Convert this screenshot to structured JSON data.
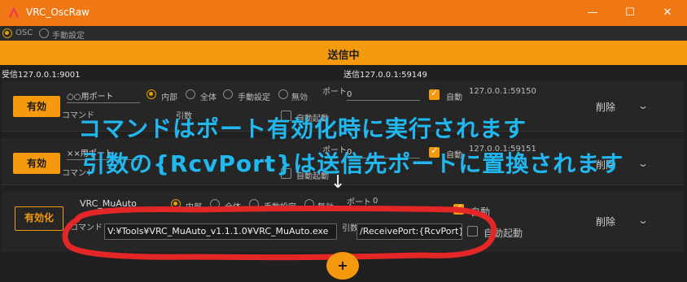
{
  "window": {
    "title": "VRC_OscRaw",
    "minimize": "—",
    "maximize": "☐",
    "close": "✕"
  },
  "mode": {
    "osc_label": "OSC",
    "manual_label": "手動設定"
  },
  "sendbar": {
    "label": "送信中"
  },
  "addresses": {
    "receive": "受信127.0.0.1:9001",
    "send": "送信127.0.0.1:59149"
  },
  "rows": [
    {
      "button": "有効",
      "name_label": "○○用ポート",
      "cmd_label": "コマンド",
      "opt_internal": "内部",
      "opt_all": "全体",
      "opt_manual": "手動設定",
      "opt_none": "無効",
      "port_label": "ポート",
      "port_value": "0",
      "arg_label": "引数",
      "auto_label": "自動",
      "autostart_label": "自動起動",
      "addr": "127.0.0.1:59150",
      "delete": "削除"
    },
    {
      "button": "有効",
      "name_label": "××用ポート",
      "cmd_label": "コマンド",
      "port_label": "ポート",
      "port_value": "0",
      "auto_label": "自動",
      "autostart_label": "自動起動",
      "addr": "127.0.0.1:59151",
      "delete": "削除"
    },
    {
      "button": "有効化",
      "name_label": "VRC_MuAuto",
      "cmd_label": "コマンド",
      "opt_internal": "内部",
      "opt_all": "全体",
      "opt_manual": "手動設定",
      "opt_none": "無効",
      "port_label": "ポート",
      "port_value": "0",
      "arg_label": "引数",
      "exe_value": "V:¥Tools¥VRC_MuAuto_v1.1.1.0¥VRC_MuAuto.exe",
      "arg_value": "/ReceivePort:{RcvPort}",
      "auto_label": "自動",
      "autostart_label": "自動起動",
      "delete": "削除"
    }
  ],
  "overlay": {
    "line1": "コマンドはポート有効化時に実行されます",
    "line2": "引数の{RcvPort}は送信先ポートに置換されます",
    "arrow": "↓"
  },
  "add_button": "+",
  "colors": {
    "titlebar": "#f07814",
    "accent": "#f59a0e",
    "overlay_text": "#21b8f0",
    "highlight_circle": "#e32626"
  }
}
